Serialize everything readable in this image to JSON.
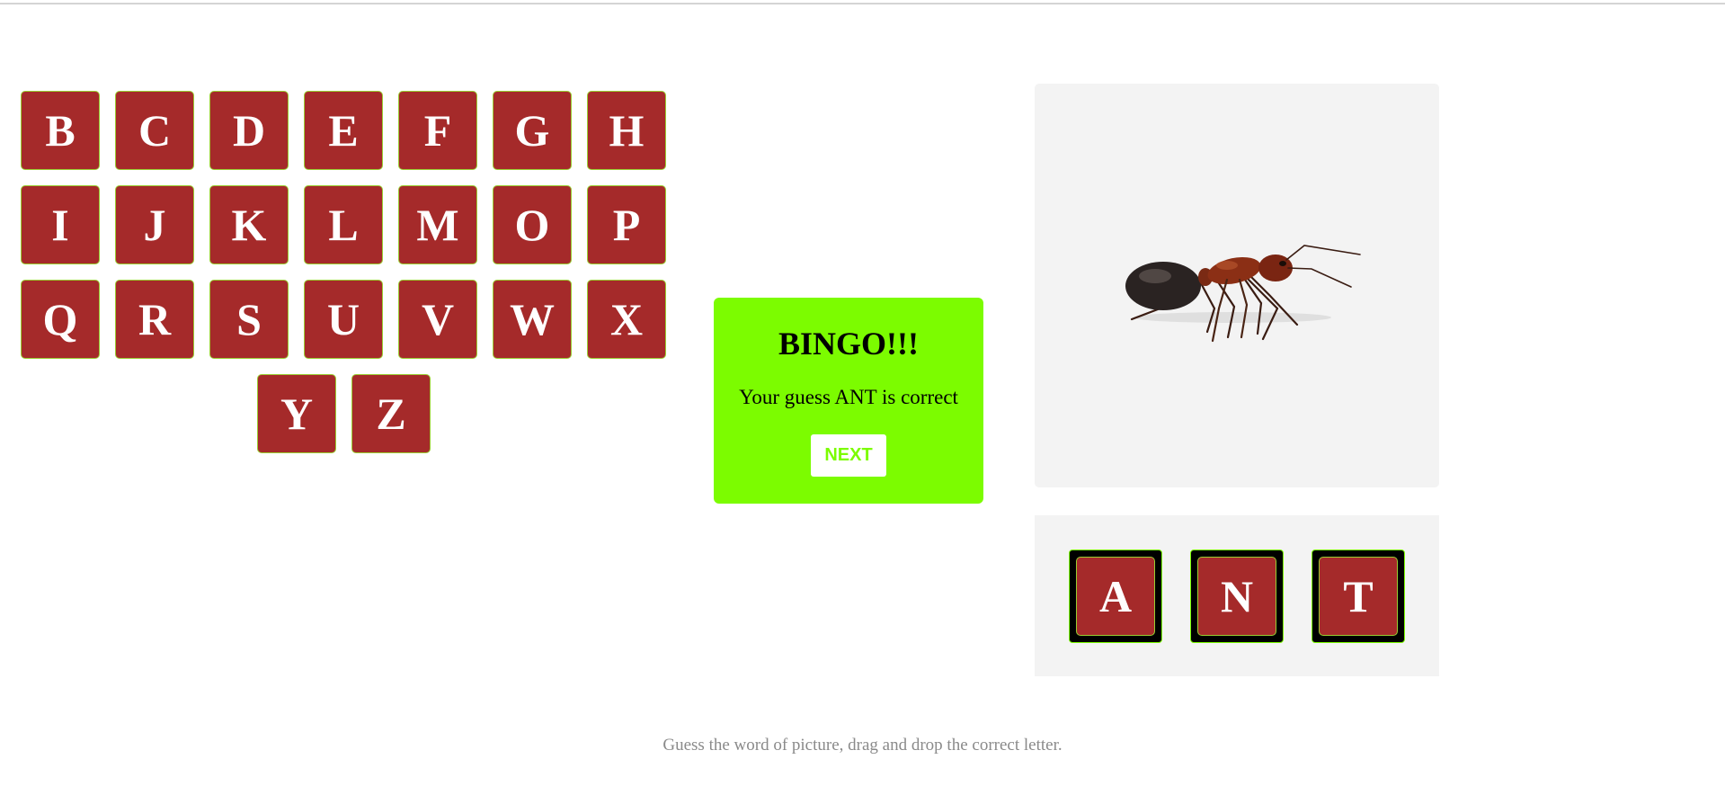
{
  "letter_bank": {
    "rows": [
      [
        "B",
        "C",
        "D",
        "E",
        "F",
        "G",
        "H"
      ],
      [
        "I",
        "J",
        "K",
        "L",
        "M",
        "O",
        "P"
      ],
      [
        "Q",
        "R",
        "S",
        "U",
        "V",
        "W",
        "X"
      ],
      [
        "Y",
        "Z"
      ]
    ]
  },
  "result": {
    "title": "BINGO!!!",
    "message": "Your guess ANT is correct",
    "next_label": "NEXT"
  },
  "picture": {
    "subject": "ant"
  },
  "answer": {
    "letters": [
      "A",
      "N",
      "T"
    ]
  },
  "footer": {
    "instruction": "Guess the word of picture, drag and drop the correct letter."
  },
  "colors": {
    "tile_background": "#a52a2a",
    "tile_border": "#9acd32",
    "bingo_background": "#7cfc00",
    "panel_background": "#f3f3f3"
  }
}
